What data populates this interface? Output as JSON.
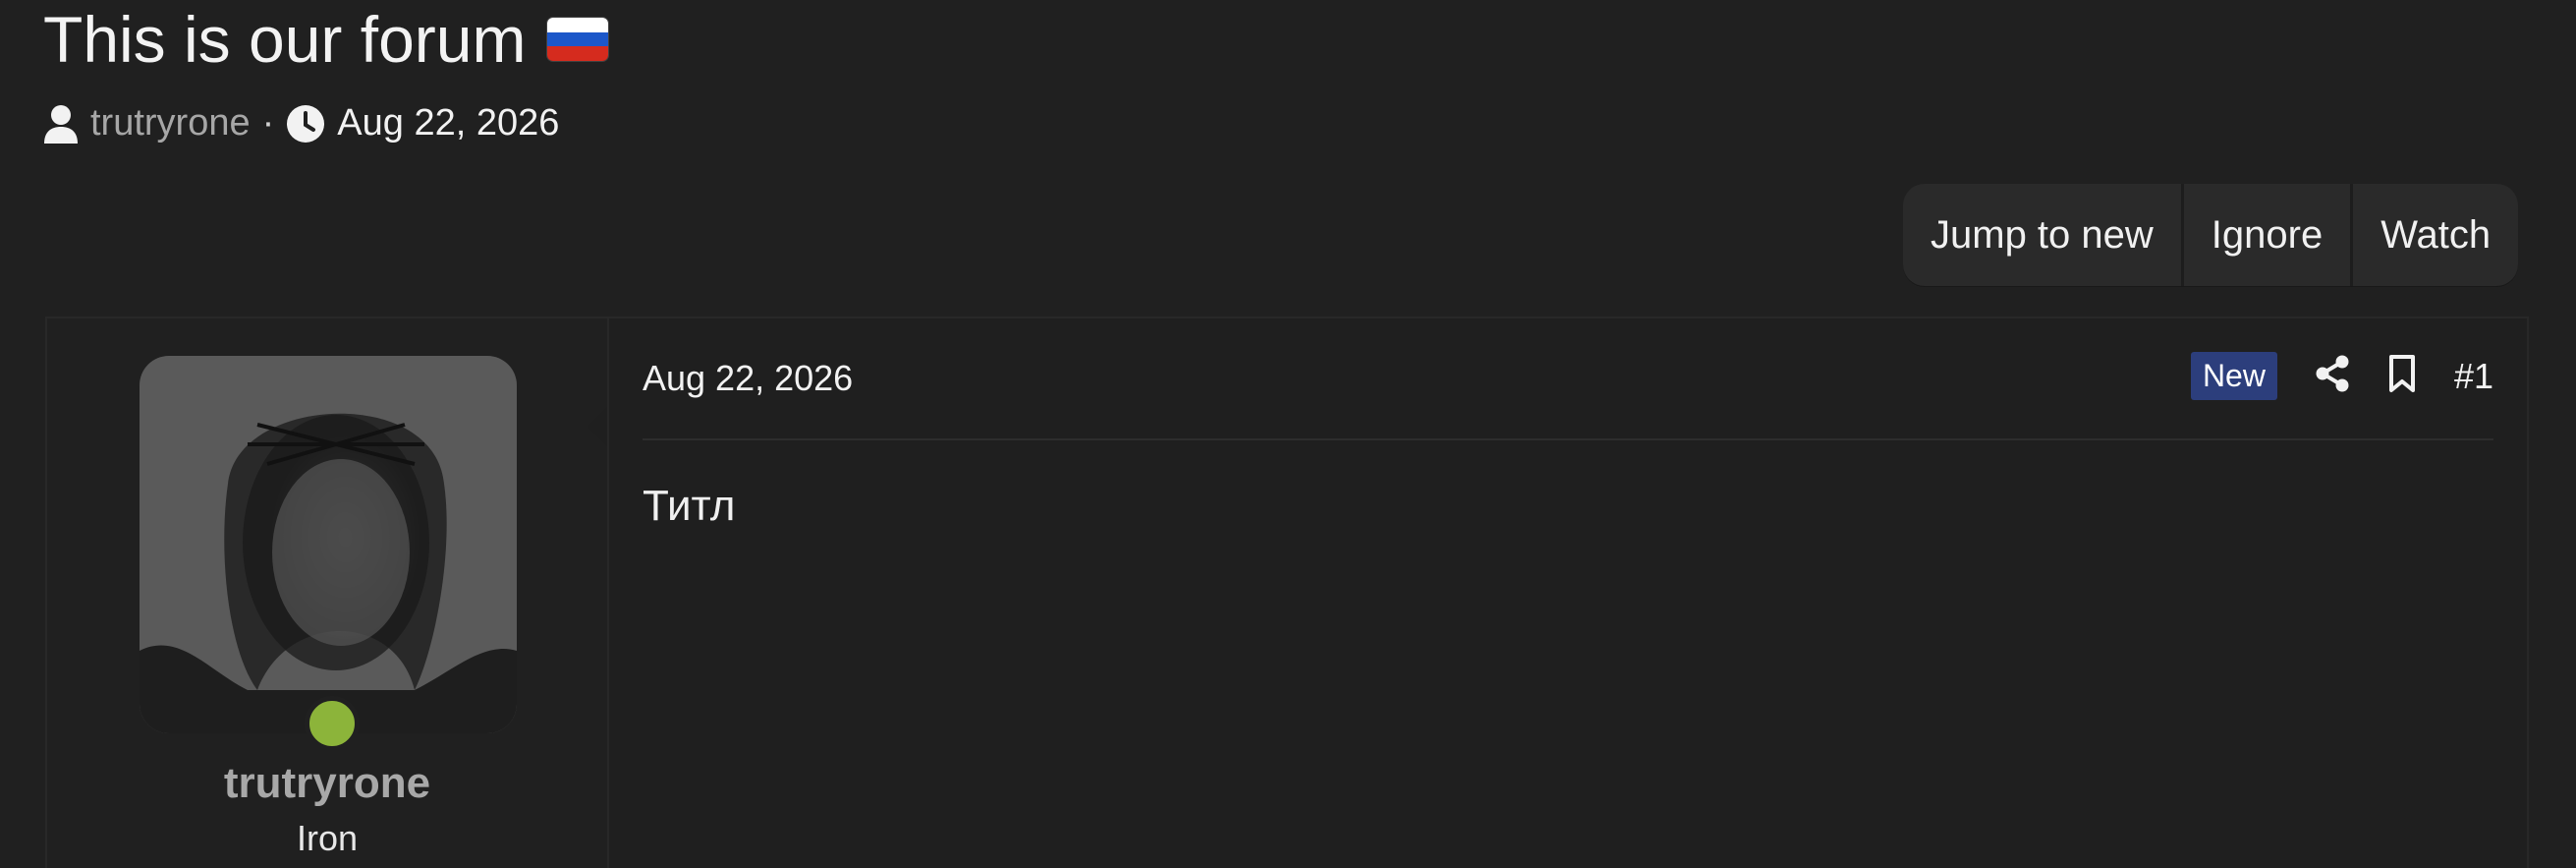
{
  "thread": {
    "title": "This is our forum",
    "flag_colors": [
      "#ffffff",
      "#1c57c9",
      "#d52b1e"
    ],
    "author": "trutryrone",
    "separator": "·",
    "date": "Aug 22, 2026"
  },
  "buttons": {
    "jump_to_new": "Jump to new",
    "ignore": "Ignore",
    "watch": "Watch"
  },
  "post": {
    "user": {
      "name": "trutryrone",
      "title": "Iron",
      "online_color": "#8cb43a"
    },
    "date": "Aug 22, 2026",
    "badge": "New",
    "number": "#1",
    "body": "Титл"
  },
  "icons": {
    "author": "user-icon",
    "date": "clock-icon",
    "share": "share-icon",
    "bookmark": "bookmark-icon"
  }
}
